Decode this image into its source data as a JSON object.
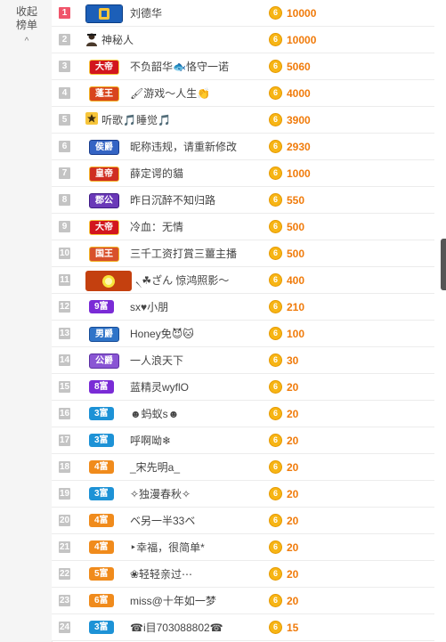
{
  "sidebar": {
    "collapse_label": "收起榜单",
    "chevron": "^"
  },
  "rows": [
    {
      "rank": "1",
      "badge": "",
      "badge_style": "b-tag",
      "name": "刘德华",
      "value": "10000"
    },
    {
      "rank": "2",
      "badge": "",
      "badge_style": "avatar",
      "name": "神秘人",
      "value": "10000"
    },
    {
      "rank": "3",
      "badge": "大帝",
      "badge_style": "b-dadi",
      "name": "不负韶华🐟恪守一诺",
      "value": "5060"
    },
    {
      "rank": "4",
      "badge": "蓬王",
      "badge_style": "b-fengwang",
      "name": "🖌游戏～人生👏",
      "value": "4000"
    },
    {
      "rank": "5",
      "badge": "",
      "badge_style": "star",
      "name": "听歌🎵睡觉🎵",
      "value": "3900"
    },
    {
      "rank": "6",
      "badge": "侯爵",
      "badge_style": "b-houjue",
      "name": "昵称违规，请重新修改",
      "value": "2930"
    },
    {
      "rank": "7",
      "badge": "皇帝",
      "badge_style": "b-huangdi",
      "name": "薛定谔的貓",
      "value": "1000"
    },
    {
      "rank": "8",
      "badge": "郡公",
      "badge_style": "b-jungong",
      "name": "昨日沉醉不知归路",
      "value": "550"
    },
    {
      "rank": "9",
      "badge": "大帝",
      "badge_style": "b-dadi",
      "name": "冷血：无情",
      "value": "500"
    },
    {
      "rank": "10",
      "badge": "国王",
      "badge_style": "b-guowang",
      "name": "三千工资打賞三薑主播",
      "value": "500"
    },
    {
      "rank": "11",
      "badge": "",
      "badge_style": "b-fire",
      "name": "৲☘ざん 惊鸿照影～",
      "value": "400"
    },
    {
      "rank": "12",
      "badge": "9富",
      "badge_style": "b-purple",
      "name": "sx♥小朋",
      "value": "210"
    },
    {
      "rank": "13",
      "badge": "男爵",
      "badge_style": "b-nanjue",
      "name": "Honey免😈🐱",
      "value": "100"
    },
    {
      "rank": "14",
      "badge": "公爵",
      "badge_style": "b-gongjue",
      "name": "一人浪天下",
      "value": "30"
    },
    {
      "rank": "15",
      "badge": "8富",
      "badge_style": "b-purple",
      "name": "蓝精灵wyflO",
      "value": "20"
    },
    {
      "rank": "16",
      "badge": "3富",
      "badge_style": "b-blue",
      "name": "☻蚂蚁s☻",
      "value": "20"
    },
    {
      "rank": "17",
      "badge": "3富",
      "badge_style": "b-blue",
      "name": "呼啊呦❄",
      "value": "20"
    },
    {
      "rank": "18",
      "badge": "4富",
      "badge_style": "b-orange",
      "name": "_宋先明a_",
      "value": "20"
    },
    {
      "rank": "19",
      "badge": "3富",
      "badge_style": "b-blue",
      "name": "✧独漫春秋✧",
      "value": "20"
    },
    {
      "rank": "20",
      "badge": "4富",
      "badge_style": "b-orange",
      "name": "ベ另一半33ベ",
      "value": "20"
    },
    {
      "rank": "21",
      "badge": "4富",
      "badge_style": "b-orange",
      "name": "‣幸福，很简单*",
      "value": "20"
    },
    {
      "rank": "22",
      "badge": "5富",
      "badge_style": "b-orange",
      "name": "❀轻轻亲过⋯",
      "value": "20"
    },
    {
      "rank": "23",
      "badge": "6富",
      "badge_style": "b-orange",
      "name": "miss@十年如一梦",
      "value": "20"
    },
    {
      "rank": "24",
      "badge": "3富",
      "badge_style": "b-blue",
      "name": "☎i目703088802☎",
      "value": "15"
    }
  ],
  "coin_glyph": "6",
  "colors": {
    "value": "#f07b0b",
    "coin": "#f7b515",
    "rank_first": "#f0556b",
    "rank_default": "#c4c4c4"
  }
}
